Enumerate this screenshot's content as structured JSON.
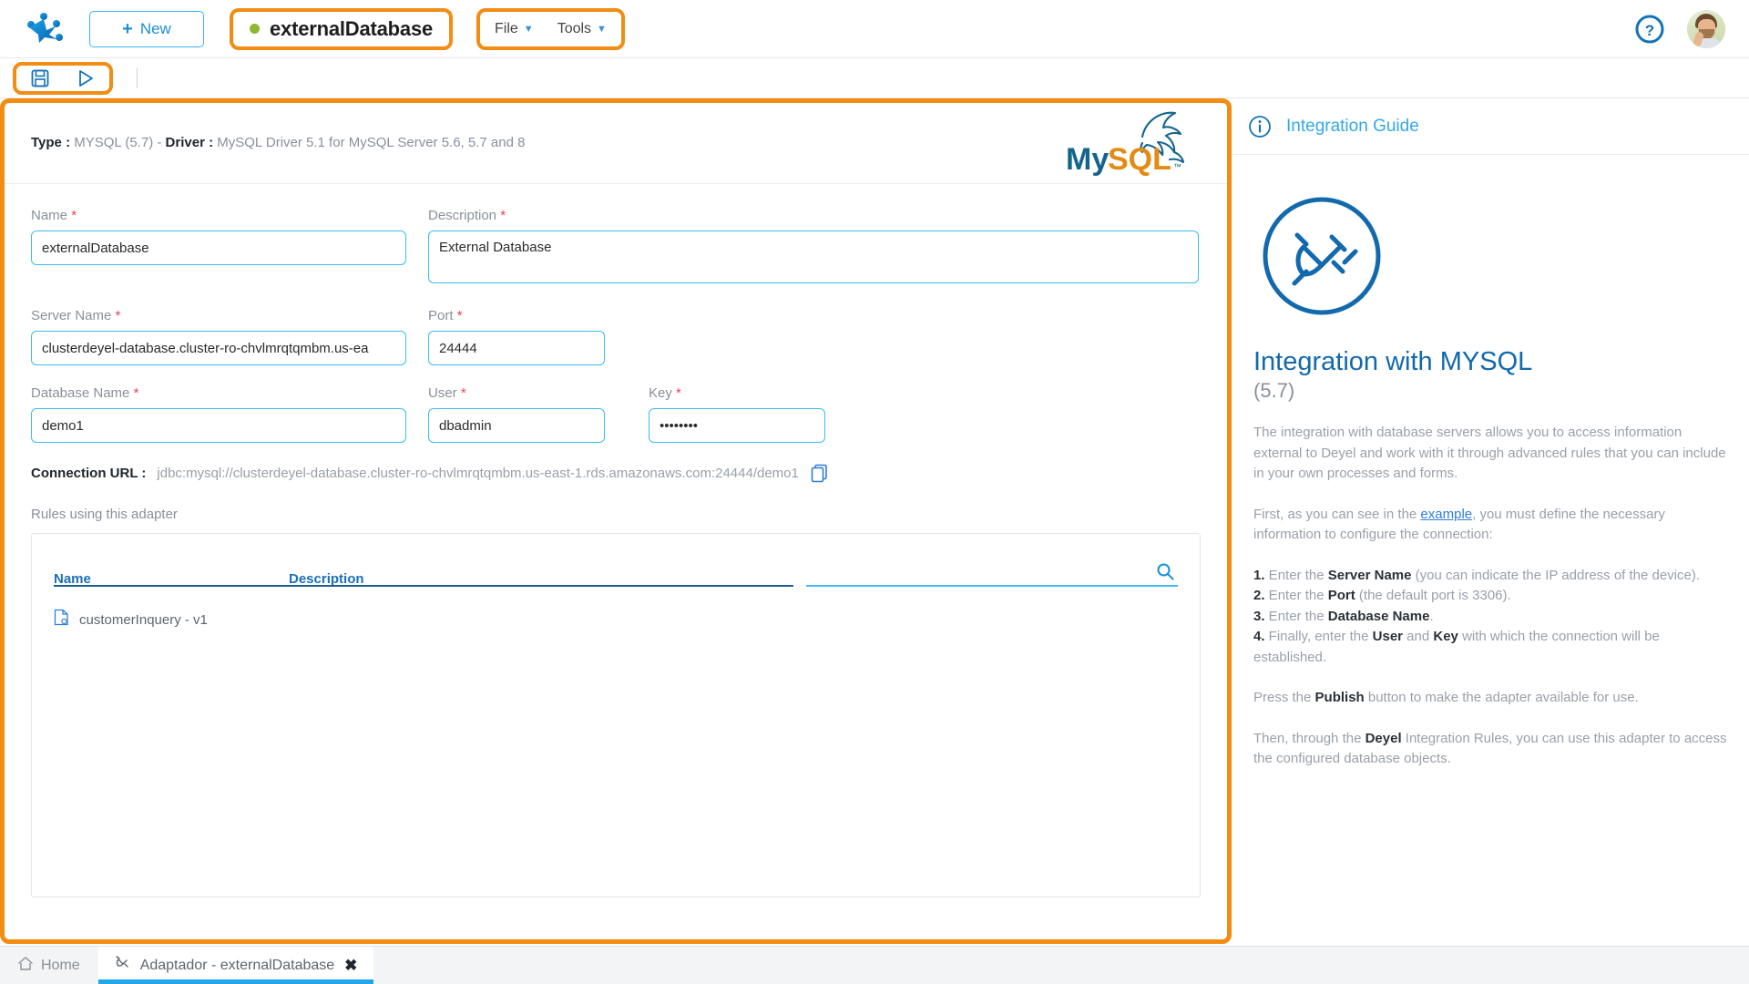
{
  "topbar": {
    "logo_icon": "deyel-paw-logo",
    "new_button": "New",
    "document_title": "externalDatabase",
    "status_dot_color": "#8cb832",
    "menus": [
      "File",
      "Tools"
    ],
    "help_icon": "question-circle-icon",
    "avatar_icon": "user-avatar"
  },
  "actionbar": {
    "save_icon": "save-floppy-icon",
    "publish_icon": "publish-play-icon"
  },
  "adapter": {
    "type_label": "Type :",
    "type_value": "MYSQL (5.7)",
    "separator": "-",
    "driver_label": "Driver :",
    "driver_value": "MySQL Driver 5.1 for MySQL Server 5.6, 5.7 and 8",
    "logo_text": "MySQL",
    "logo_tm": "™"
  },
  "form": {
    "name": {
      "label": "Name",
      "required": "*",
      "value": "externalDatabase",
      "placeholder": ""
    },
    "description": {
      "label": "Description",
      "required": "*",
      "value": "External Database",
      "placeholder": ""
    },
    "server_name": {
      "label": "Server Name",
      "required": "*",
      "value": "clusterdeyel-database.cluster-ro-chvlmrqtqmbm.us-ea",
      "placeholder": ""
    },
    "port": {
      "label": "Port",
      "required": "*",
      "value": "24444",
      "placeholder": ""
    },
    "database_name": {
      "label": "Database Name",
      "required": "*",
      "value": "demo1",
      "placeholder": ""
    },
    "user": {
      "label": "User",
      "required": "*",
      "value": "dbadmin",
      "placeholder": ""
    },
    "key": {
      "label": "Key",
      "required": "*",
      "value": "••••••••",
      "placeholder": ""
    }
  },
  "connection": {
    "label": "Connection URL :",
    "url": "jdbc:mysql://clusterdeyel-database.cluster-ro-chvlmrqtqmbm.us-east-1.rds.amazonaws.com:24444/demo1",
    "copy_icon": "copy-icon"
  },
  "rules": {
    "section_label": "Rules using this adapter",
    "columns": [
      "Name",
      "Description"
    ],
    "search_icon": "search-icon",
    "search_value": "",
    "rows": [
      {
        "icon": "rule-document-icon",
        "name": "customerInquery - v1",
        "description": ""
      }
    ]
  },
  "guide": {
    "header_icon": "info-circle-icon",
    "header_title": "Integration Guide",
    "hero_icon": "plug-disconnected-icon",
    "title": "Integration with MYSQL",
    "subtitle": "(5.7)",
    "paragraph_1": "The integration with database servers allows you to access information external to Deyel and work with it through advanced rules that you can include in your own processes and forms.",
    "paragraph_2_before": "First, as you can see in the ",
    "paragraph_2_link": "example",
    "paragraph_2_after": ", you must define the necessary information to configure the connection:",
    "steps": [
      {
        "num": "1.",
        "before": " Enter the ",
        "bold": "Server Name",
        "after": " (you can indicate the IP address of the device)."
      },
      {
        "num": "2.",
        "before": " Enter the ",
        "bold": "Port",
        "after": " (the default port is 3306)."
      },
      {
        "num": "3.",
        "before": " Enter the ",
        "bold": "Database Name",
        "after": "."
      },
      {
        "num": "4.",
        "before": " Finally, enter the ",
        "bold": "User",
        "after": " and "
      }
    ],
    "step4_bold2": "Key",
    "step4_tail": " with which the connection will be established.",
    "paragraph_3_before": "Press the ",
    "paragraph_3_bold": "Publish",
    "paragraph_3_after": " button to make the adapter available for use.",
    "paragraph_4_before": "Then, through the ",
    "paragraph_4_bold": "Deyel",
    "paragraph_4_after": " Integration Rules, you can use this adapter to access the configured database objects."
  },
  "taskbar": {
    "home_icon": "home-icon",
    "home_label": "Home",
    "tab_icon": "adapter-plug-icon",
    "tab_label": "Adaptador - externalDatabase",
    "close_icon": "close-x-icon"
  },
  "colors": {
    "highlight": "#f28c12",
    "accent_blue": "#1b8fd4",
    "cyan": "#3cbcef",
    "status_green": "#8cb832",
    "required_red": "#f0404a"
  }
}
